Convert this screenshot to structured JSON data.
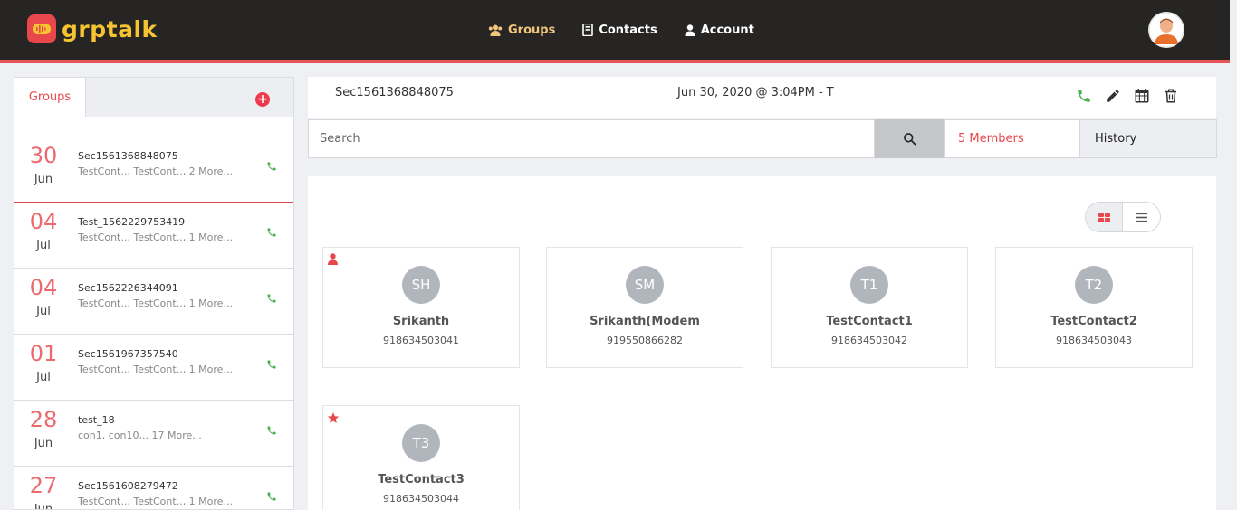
{
  "brand": {
    "name": "grptalk"
  },
  "nav": {
    "items": [
      {
        "label": "Groups",
        "icon": "users-icon",
        "active": true
      },
      {
        "label": "Contacts",
        "icon": "address-book-icon",
        "active": false
      },
      {
        "label": "Account",
        "icon": "user-icon",
        "active": false
      }
    ]
  },
  "sidebar": {
    "tab_label": "Groups",
    "add_icon": "plus-circle-icon",
    "groups": [
      {
        "day": "30",
        "month": "Jun",
        "name": "Sec1561368848075",
        "members": "TestCont.., TestCont.., 2 More..."
      },
      {
        "day": "04",
        "month": "Jul",
        "name": "Test_1562229753419",
        "members": "TestCont.., TestCont.., 1 More..."
      },
      {
        "day": "04",
        "month": "Jul",
        "name": "Sec1562226344091",
        "members": "TestCont.., TestCont.., 1 More..."
      },
      {
        "day": "01",
        "month": "Jul",
        "name": "Sec1561967357540",
        "members": "TestCont.., TestCont.., 1 More..."
      },
      {
        "day": "28",
        "month": "Jun",
        "name": "test_18",
        "members": "con1, con10,.. 17 More..."
      },
      {
        "day": "27",
        "month": "Jun",
        "name": "Sec1561608279472",
        "members": "TestCont.., TestCont.., 1 More..."
      }
    ]
  },
  "main": {
    "title": "Sec1561368848075",
    "datetime": "Jun 30, 2020 @ 3:04PM - T",
    "actions": [
      "phone-icon",
      "pencil-icon",
      "calendar-icon",
      "trash-icon"
    ],
    "search_placeholder": "Search",
    "members_tab": "5 Members",
    "history_tab": "History",
    "members": [
      {
        "initials": "SH",
        "name": "Srikanth",
        "phone": "918634503041",
        "badge": "user-icon"
      },
      {
        "initials": "SM",
        "name": "Srikanth(Modem",
        "phone": "919550866282",
        "badge": ""
      },
      {
        "initials": "T1",
        "name": "TestContact1",
        "phone": "918634503042",
        "badge": ""
      },
      {
        "initials": "T2",
        "name": "TestContact2",
        "phone": "918634503043",
        "badge": ""
      },
      {
        "initials": "T3",
        "name": "TestContact3",
        "phone": "918634503044",
        "badge": "star-icon"
      }
    ]
  },
  "colors": {
    "accent": "#e8484c",
    "navbar": "#262523",
    "brand_yellow": "#f6c431",
    "call_green": "#4caf50"
  }
}
